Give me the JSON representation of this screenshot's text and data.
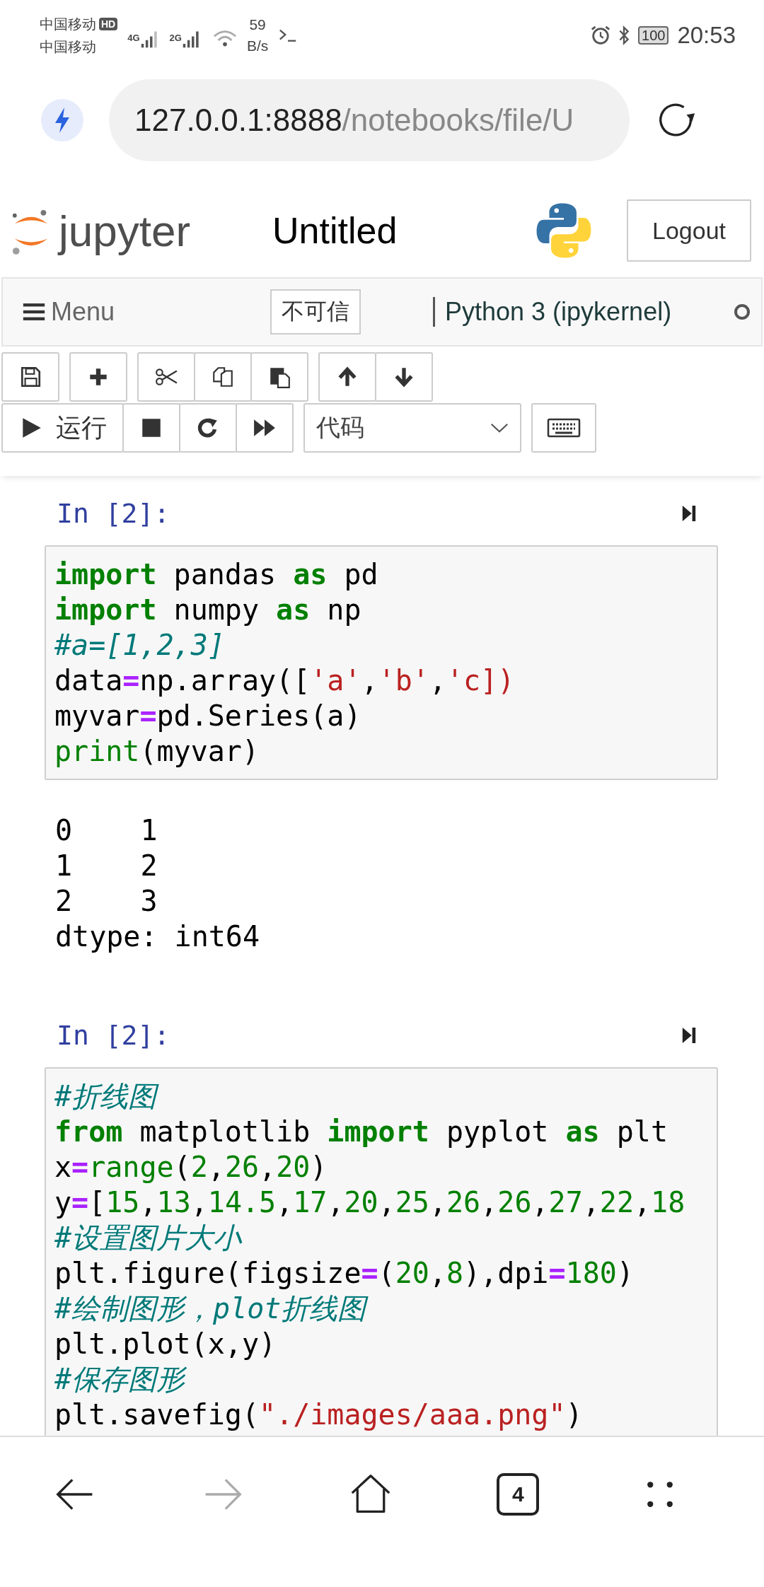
{
  "status_bar": {
    "carrier_1": "中国移动",
    "hd_badge": "HD",
    "carrier_2": "中国移动",
    "signal_1_label": "4G",
    "signal_2_label": "2G",
    "speed_value": "59",
    "speed_unit": "B/s",
    "battery": "100",
    "time": "20:53"
  },
  "address_bar": {
    "host": "127.0.0.1:8888",
    "path": "/notebooks/file/U"
  },
  "header": {
    "logo_text": "jupyter",
    "notebook_title": "Untitled",
    "logout_button": "Logout"
  },
  "menu_bar": {
    "menu_label": "Menu",
    "trust_badge": "不可信",
    "kernel_name": "Python 3 (ipykernel)",
    "kernel_busy": false
  },
  "toolbar": {
    "run_label": "运行",
    "cell_type": "代码"
  },
  "cells": [
    {
      "prompt": "In [2]:",
      "code": [
        [
          {
            "kind": "keyword",
            "text": "import"
          },
          {
            "kind": "plain",
            "text": " pandas "
          },
          {
            "kind": "keyword",
            "text": "as"
          },
          {
            "kind": "plain",
            "text": " pd"
          }
        ],
        [
          {
            "kind": "keyword",
            "text": "import"
          },
          {
            "kind": "plain",
            "text": " numpy "
          },
          {
            "kind": "keyword",
            "text": "as"
          },
          {
            "kind": "plain",
            "text": " np"
          }
        ],
        [
          {
            "kind": "comment",
            "text": "#a=[1,2,3]"
          }
        ],
        [
          {
            "kind": "plain",
            "text": "data"
          },
          {
            "kind": "operator",
            "text": "="
          },
          {
            "kind": "plain",
            "text": "np.array(["
          },
          {
            "kind": "string",
            "text": "'a'"
          },
          {
            "kind": "plain",
            "text": ","
          },
          {
            "kind": "string",
            "text": "'b'"
          },
          {
            "kind": "plain",
            "text": ","
          },
          {
            "kind": "string",
            "text": "'c])"
          }
        ],
        [
          {
            "kind": "plain",
            "text": "myvar"
          },
          {
            "kind": "operator",
            "text": "="
          },
          {
            "kind": "plain",
            "text": "pd.Series(a)"
          }
        ],
        [
          {
            "kind": "builtin",
            "text": "print"
          },
          {
            "kind": "plain",
            "text": "(myvar)"
          }
        ]
      ],
      "output": [
        "0    1",
        "1    2",
        "2    3",
        "dtype: int64"
      ]
    },
    {
      "prompt": "In [2]:",
      "code": [
        [
          {
            "kind": "comment",
            "text": "#折线图"
          }
        ],
        [
          {
            "kind": "keyword",
            "text": "from"
          },
          {
            "kind": "plain",
            "text": " matplotlib "
          },
          {
            "kind": "keyword",
            "text": "import"
          },
          {
            "kind": "plain",
            "text": " pyplot "
          },
          {
            "kind": "keyword",
            "text": "as"
          },
          {
            "kind": "plain",
            "text": " plt"
          }
        ],
        [
          {
            "kind": "plain",
            "text": "x"
          },
          {
            "kind": "operator",
            "text": "="
          },
          {
            "kind": "builtin",
            "text": "range"
          },
          {
            "kind": "plain",
            "text": "("
          },
          {
            "kind": "number",
            "text": "2"
          },
          {
            "kind": "plain",
            "text": ","
          },
          {
            "kind": "number",
            "text": "26"
          },
          {
            "kind": "plain",
            "text": ","
          },
          {
            "kind": "number",
            "text": "20"
          },
          {
            "kind": "plain",
            "text": ")"
          }
        ],
        [
          {
            "kind": "plain",
            "text": "y"
          },
          {
            "kind": "operator",
            "text": "="
          },
          {
            "kind": "plain",
            "text": "["
          },
          {
            "kind": "number",
            "text": "15"
          },
          {
            "kind": "plain",
            "text": ","
          },
          {
            "kind": "number",
            "text": "13"
          },
          {
            "kind": "plain",
            "text": ","
          },
          {
            "kind": "number",
            "text": "14.5"
          },
          {
            "kind": "plain",
            "text": ","
          },
          {
            "kind": "number",
            "text": "17"
          },
          {
            "kind": "plain",
            "text": ","
          },
          {
            "kind": "number",
            "text": "20"
          },
          {
            "kind": "plain",
            "text": ","
          },
          {
            "kind": "number",
            "text": "25"
          },
          {
            "kind": "plain",
            "text": ","
          },
          {
            "kind": "number",
            "text": "26"
          },
          {
            "kind": "plain",
            "text": ","
          },
          {
            "kind": "number",
            "text": "26"
          },
          {
            "kind": "plain",
            "text": ","
          },
          {
            "kind": "number",
            "text": "27"
          },
          {
            "kind": "plain",
            "text": ","
          },
          {
            "kind": "number",
            "text": "22"
          },
          {
            "kind": "plain",
            "text": ","
          },
          {
            "kind": "number",
            "text": "18"
          }
        ],
        [
          {
            "kind": "comment",
            "text": "#设置图片大小"
          }
        ],
        [
          {
            "kind": "plain",
            "text": "plt.figure(figsize"
          },
          {
            "kind": "operator",
            "text": "="
          },
          {
            "kind": "plain",
            "text": "("
          },
          {
            "kind": "number",
            "text": "20"
          },
          {
            "kind": "plain",
            "text": ","
          },
          {
            "kind": "number",
            "text": "8"
          },
          {
            "kind": "plain",
            "text": "),dpi"
          },
          {
            "kind": "operator",
            "text": "="
          },
          {
            "kind": "number",
            "text": "180"
          },
          {
            "kind": "plain",
            "text": ")"
          }
        ],
        [
          {
            "kind": "comment",
            "text": "#绘制图形，plot折线图"
          }
        ],
        [
          {
            "kind": "plain",
            "text": "plt.plot(x,y)"
          }
        ],
        [
          {
            "kind": "comment",
            "text": "#保存图形"
          }
        ],
        [
          {
            "kind": "plain",
            "text": "plt.savefig("
          },
          {
            "kind": "string",
            "text": "\"./images/aaa.png\""
          },
          {
            "kind": "plain",
            "text": ")"
          }
        ]
      ]
    }
  ],
  "bottom_nav": {
    "forward_disabled": true,
    "tab_count": "4"
  }
}
